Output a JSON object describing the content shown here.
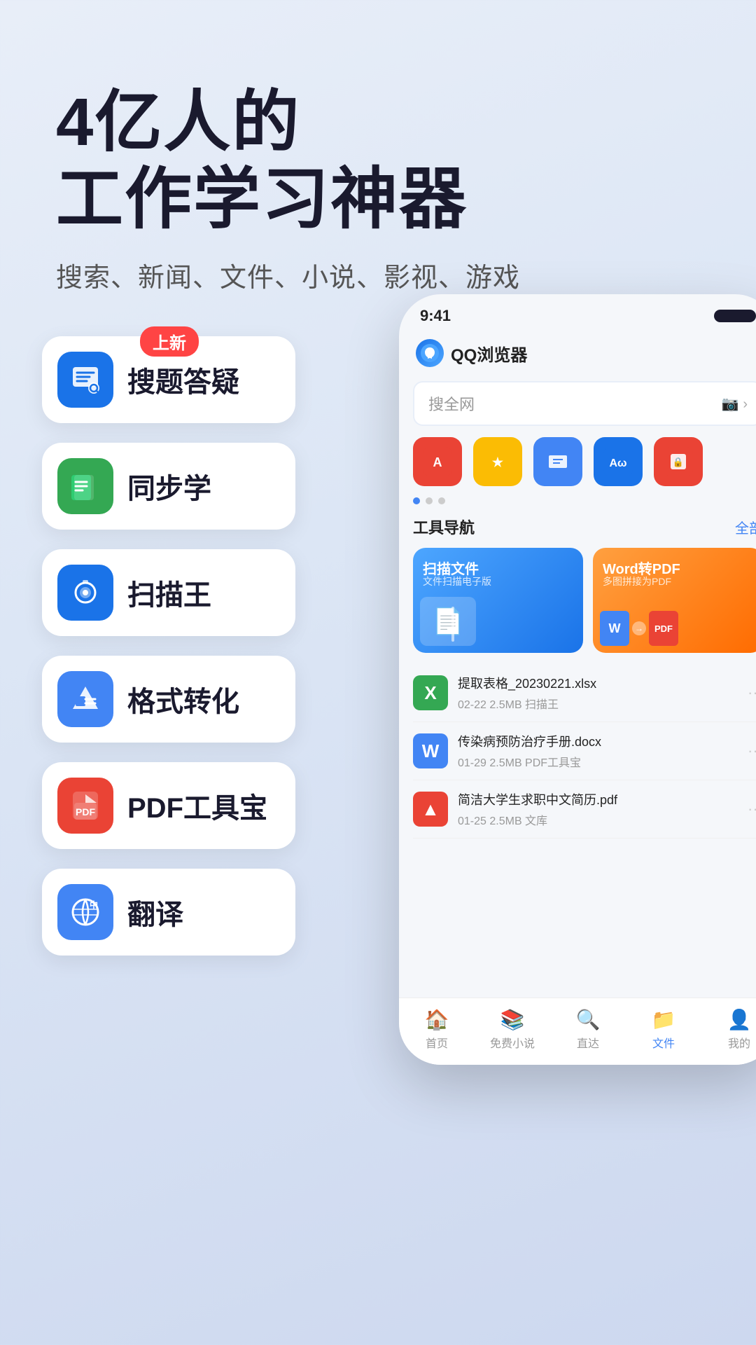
{
  "hero": {
    "title_line1": "4亿人的",
    "title_line2": "工作学习神器",
    "subtitle": "搜索、新闻、文件、小说、影视、游戏"
  },
  "badge": {
    "label": "上新"
  },
  "features": [
    {
      "id": "soti",
      "label": "搜题答疑",
      "icon": "🔍",
      "color": "icon-soti",
      "has_badge": true
    },
    {
      "id": "tongbu",
      "label": "同步学",
      "icon": "📖",
      "color": "icon-tongbu",
      "has_badge": false
    },
    {
      "id": "scan",
      "label": "扫描王",
      "icon": "📷",
      "color": "icon-scan",
      "has_badge": false
    },
    {
      "id": "format",
      "label": "格式转化",
      "icon": "⚡",
      "color": "icon-format",
      "has_badge": false
    },
    {
      "id": "pdf",
      "label": "PDF工具宝",
      "icon": "🔺",
      "color": "icon-pdf",
      "has_badge": false
    },
    {
      "id": "translate",
      "label": "翻译",
      "icon": "🌐",
      "color": "icon-translate",
      "has_badge": false
    }
  ],
  "phone": {
    "status_time": "9:41",
    "app_name": "QQ浏览器",
    "search_placeholder": "搜全网",
    "tools_title": "工具导航",
    "tools_all": "全部",
    "tool_scan_label": "扫描文件",
    "tool_scan_sub": "文件扫描电子版",
    "tool_word_label": "Word转PDF",
    "tool_word_sub": "多图拼接为PDF",
    "tool_word_badge": "PDF"
  },
  "files": [
    {
      "name": "提取表格_20230221.xlsx",
      "meta": "02-22  2.5MB  扫描王",
      "icon": "X",
      "color": "fi-green"
    },
    {
      "name": "传染病预防治疗手册.docx",
      "meta": "01-29  2.5MB  PDF工具宝",
      "icon": "W",
      "color": "fi-blue"
    },
    {
      "name": "简洁大学生求职中文简历.pdf",
      "meta": "01-25  2.5MB  文库",
      "icon": "▲",
      "color": "fi-red"
    }
  ],
  "nav": [
    {
      "label": "首页",
      "icon": "🏠",
      "active": false
    },
    {
      "label": "免费小说",
      "icon": "📚",
      "active": false
    },
    {
      "label": "直达",
      "icon": "🔍",
      "active": false
    },
    {
      "label": "文件",
      "icon": "📁",
      "active": true
    },
    {
      "label": "我的",
      "icon": "👤",
      "active": false
    }
  ]
}
